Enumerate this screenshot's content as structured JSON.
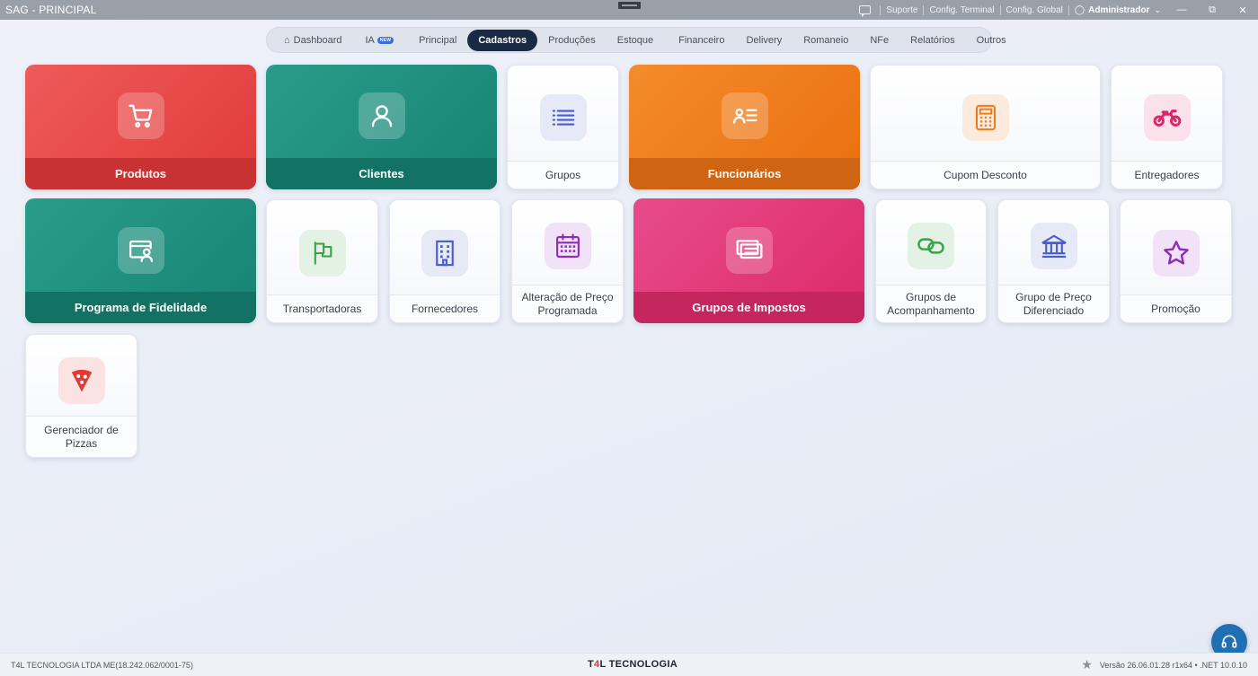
{
  "window": {
    "title": "SAG - PRINCIPAL",
    "links": [
      "Suporte",
      "Config. Terminal",
      "Config. Global"
    ],
    "user": "Administrador"
  },
  "nav": {
    "items": [
      "Dashboard",
      "IA",
      "Principal",
      "Cadastros",
      "Produções",
      "Estoque",
      "Financeiro",
      "Delivery",
      "Romaneio",
      "NFe",
      "Relatórios",
      "Outros"
    ],
    "active": "Cadastros",
    "ia_badge": "NEW"
  },
  "tiles": [
    {
      "label": "Produtos",
      "icon": "cart-icon",
      "style": "red"
    },
    {
      "label": "Clientes",
      "icon": "user-icon",
      "style": "teal"
    },
    {
      "label": "Grupos",
      "icon": "list-icon",
      "style": "white",
      "accent": "#4a5bd0"
    },
    {
      "label": "Funcionários",
      "icon": "id-card-icon",
      "style": "orange"
    },
    {
      "label": "Cupom Desconto",
      "icon": "calculator-icon",
      "style": "white",
      "accent": "#f07a1c"
    },
    {
      "label": "Entregadores",
      "icon": "motorcycle-icon",
      "style": "white",
      "accent": "#e0246a"
    },
    {
      "label": "Programa de Fidelidade",
      "icon": "loyalty-icon",
      "style": "teal"
    },
    {
      "label": "Transportadoras",
      "icon": "flag-icon",
      "style": "white",
      "accent": "#3aa24a"
    },
    {
      "label": "Fornecedores",
      "icon": "building-icon",
      "style": "white",
      "accent": "#4a5bd0"
    },
    {
      "label": "Alteração de Preço Programada",
      "icon": "calendar-icon",
      "style": "white",
      "accent": "#8e2bb8"
    },
    {
      "label": "Grupos de Impostos",
      "icon": "tax-icon",
      "style": "pink"
    },
    {
      "label": "Grupos de Acompanhamento",
      "icon": "link-icon",
      "style": "white",
      "accent": "#3aa24a"
    },
    {
      "label": "Grupo de Preço Diferenciado",
      "icon": "bank-icon",
      "style": "white",
      "accent": "#4a5bd0"
    },
    {
      "label": "Promoção",
      "icon": "star-icon",
      "style": "white",
      "accent": "#8e2bb8"
    },
    {
      "label": "Gerenciador de Pizzas",
      "icon": "pizza-icon",
      "style": "white",
      "accent": "#e53935"
    }
  ],
  "status": {
    "company": "T4L TECNOLOGIA LTDA ME(18.242.062/0001-75)",
    "brand_prefix": "T",
    "brand_digit": "4",
    "brand_suffix": "L TECNOLOGIA",
    "version": "Versão 26.06.01.28 r1x64  •  .NET 10.0.10"
  }
}
